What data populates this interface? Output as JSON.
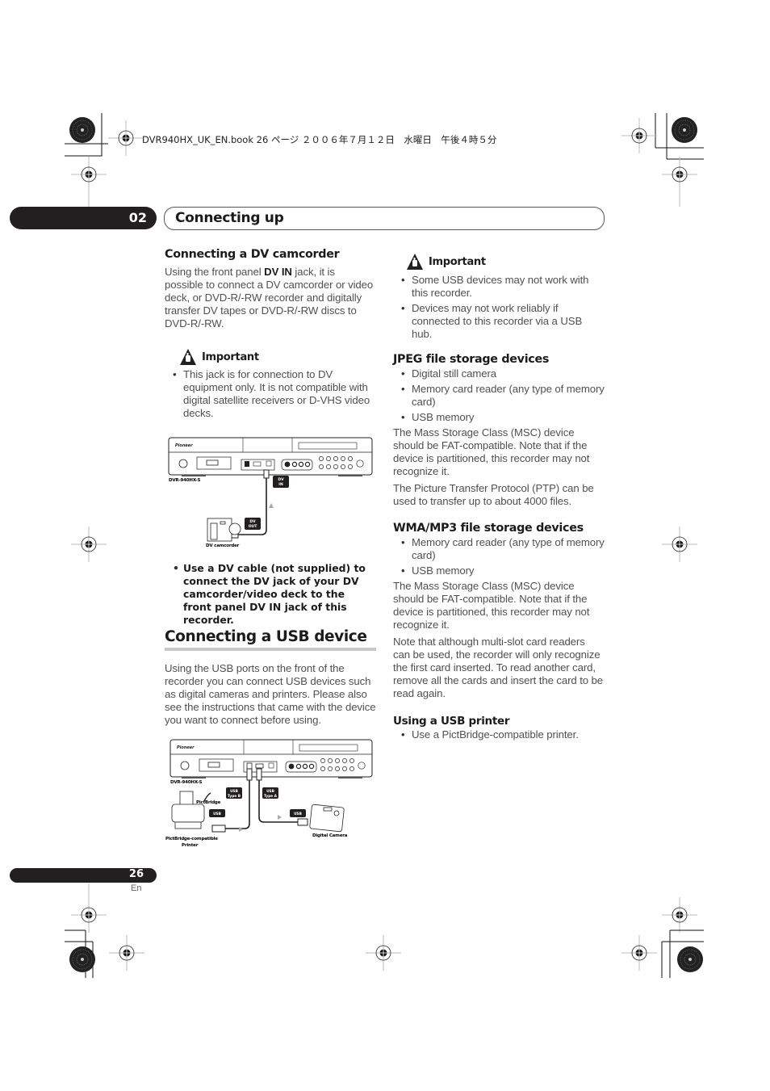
{
  "print_header": {
    "text": "DVR940HX_UK_EN.book  26 ページ  ２００６年７月１２日　水曜日　午後４時５分"
  },
  "chapter": {
    "number": "02",
    "title": "Connecting up"
  },
  "left_column": {
    "dv_section": {
      "heading": "Connecting a DV camcorder",
      "intro_pre": "Using the front panel ",
      "intro_bold": "DV IN",
      "intro_post": " jack, it is possible to connect a DV camcorder or video deck, or DVD-R/-RW recorder and digitally transfer DV tapes or DVD-R/-RW discs to DVD-R/-RW.",
      "important": {
        "label": "Important",
        "icon": "warning-hand-icon",
        "items": [
          "This jack is for connection to DV equipment only. It is not compatible with digital satellite receivers or D-VHS video decks."
        ]
      },
      "diagram": {
        "model_label": "DVR-940HX-S",
        "dv_in_label": [
          "DV",
          "IN"
        ],
        "dv_out_label": [
          "DV",
          "OUT"
        ],
        "camcorder_label": "DV camcorder"
      },
      "instruction": "Use a DV cable (not supplied) to connect the DV jack of your DV camcorder/video deck to the front panel DV IN jack of this recorder."
    },
    "usb_section": {
      "heading": "Connecting a USB device",
      "intro": "Using the USB ports on the front of the recorder you can connect USB devices such as digital cameras and printers. Please also see the instructions that came with the device you want to connect before using.",
      "diagram": {
        "model_label": "DVR-940HX-S",
        "usb_type_b_label": [
          "USB",
          "Type B"
        ],
        "usb_type_a_label": [
          "USB",
          "Type A"
        ],
        "usb_label_left": "USB",
        "usb_label_right": "USB",
        "pictbridge_label": "PictBridge",
        "printer_label": [
          "PictBridge-compatible",
          "Printer"
        ],
        "camera_label": "Digital Camera"
      }
    }
  },
  "right_column": {
    "important": {
      "label": "Important",
      "icon": "warning-hand-icon",
      "items": [
        "Some USB devices may not work with this recorder.",
        "Devices may not work reliably if connected to this recorder via a USB hub."
      ]
    },
    "jpeg_section": {
      "heading": "JPEG file storage devices",
      "items": [
        "Digital still camera",
        "Memory card reader (any type of memory card)",
        "USB memory"
      ],
      "paragraphs": [
        "The Mass Storage Class (MSC) device should be FAT-compatible. Note that if the device is partitioned, this recorder may not recognize it.",
        "The Picture Transfer Protocol (PTP) can be used to transfer up to about 4000 files."
      ]
    },
    "wma_section": {
      "heading": "WMA/MP3 file storage devices",
      "items": [
        "Memory card reader (any type of memory card)",
        "USB memory"
      ],
      "paragraphs": [
        "The Mass Storage Class (MSC) device should be FAT-compatible. Note that if the device is partitioned, this recorder may not recognize it.",
        "Note that although multi-slot card readers can be used, the recorder will only recognize the first card inserted. To read another card, remove all the cards and insert the card to be read again."
      ]
    },
    "printer_section": {
      "heading": "Using a USB printer",
      "items": [
        "Use a PictBridge-compatible printer."
      ]
    }
  },
  "footer": {
    "page_number": "26",
    "language": "En"
  }
}
